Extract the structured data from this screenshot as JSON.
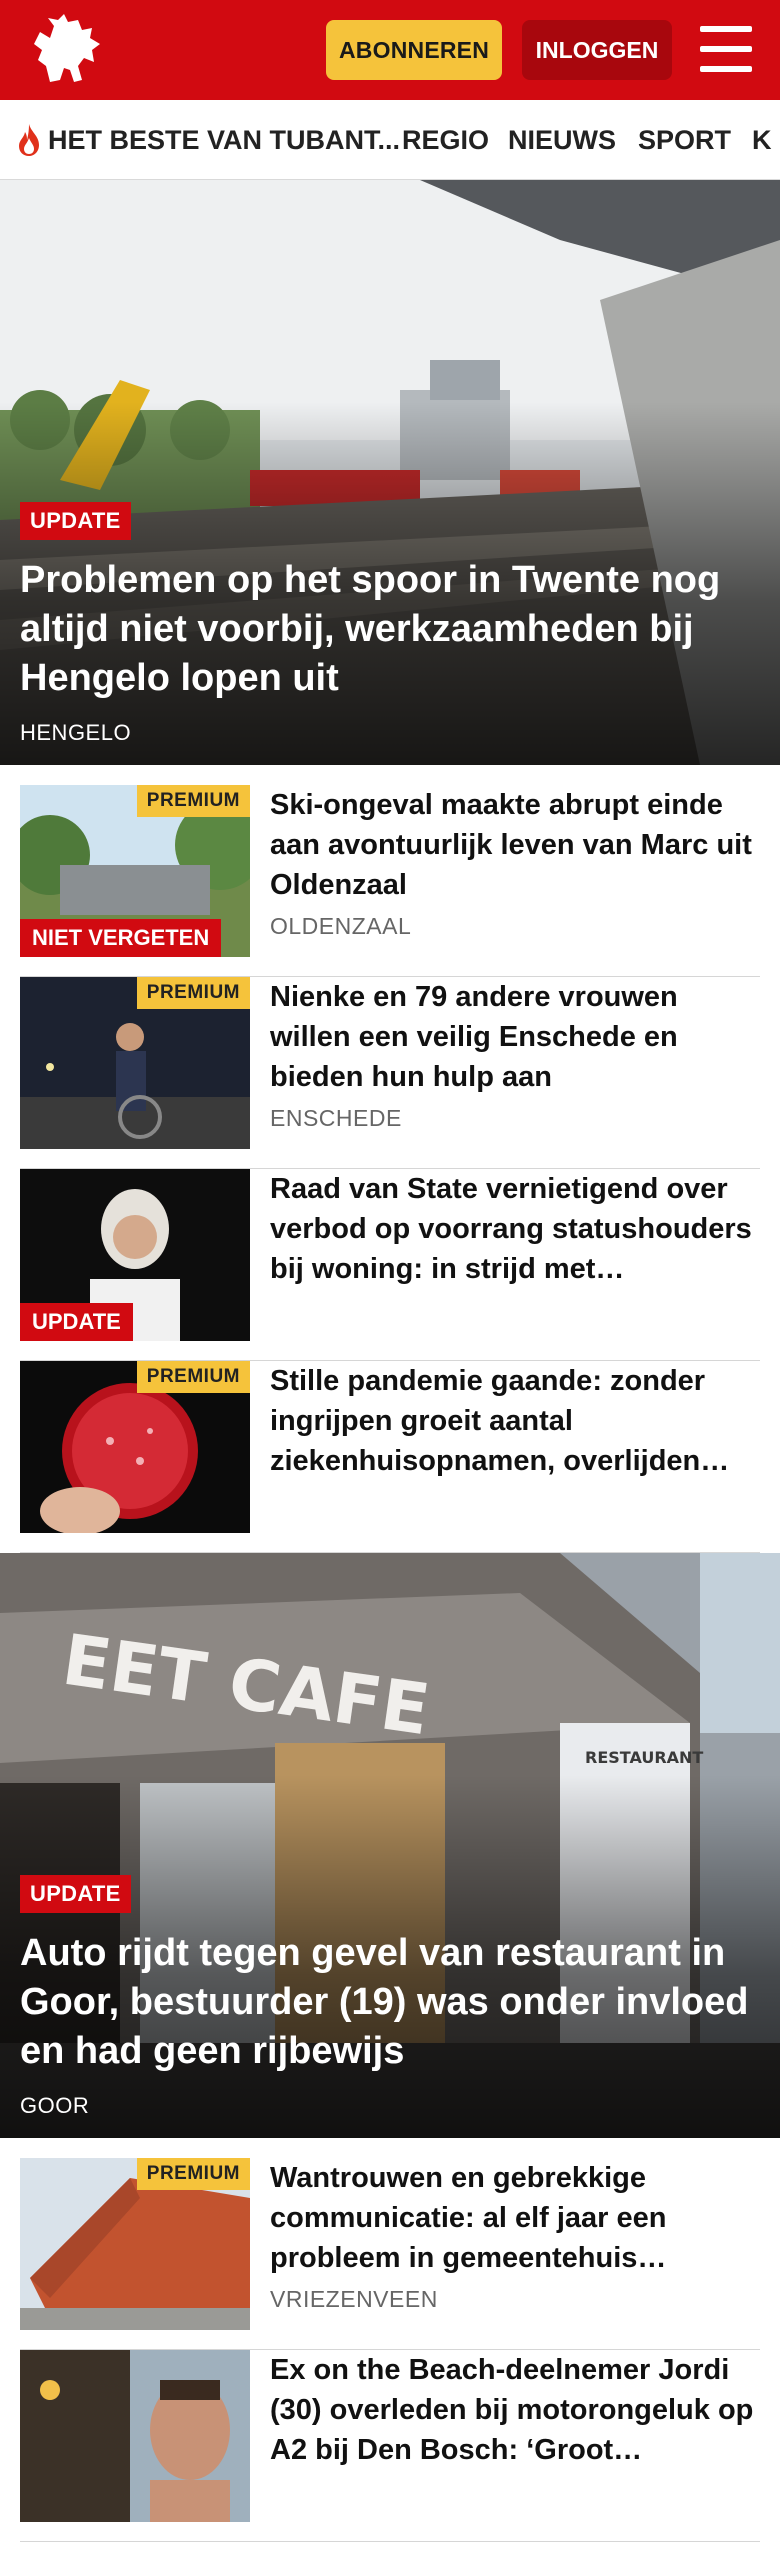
{
  "header": {
    "logo": "tubantia-horse-logo",
    "subscribe_label": "ABONNEREN",
    "login_label": "INLOGGEN",
    "menu_icon": "hamburger-icon",
    "colors": {
      "brand_red": "#d10a11",
      "accent_yellow": "#f5c33b",
      "login_dark_red": "#a8070d"
    }
  },
  "nav": {
    "items": [
      {
        "label": "HET BESTE VAN TUBANT...",
        "icon": "flame-icon"
      },
      {
        "label": "REGIO"
      },
      {
        "label": "NIEUWS"
      },
      {
        "label": "SPORT"
      },
      {
        "label": "K"
      }
    ]
  },
  "hero1": {
    "badge": "UPDATE",
    "title": "Problemen op het spoor in Twente nog altijd niet voorbij, werkzaamheden bij Hengelo lopen uit",
    "location": "HENGELO"
  },
  "articles1": [
    {
      "title": "Ski-ongeval maakte abrupt einde aan avontuurlijk leven van Marc uit Oldenzaal",
      "location": "OLDENZAAL",
      "premium": "PREMIUM",
      "tag": "NIET VERGETEN"
    },
    {
      "title": "Nienke en 79 andere vrouwen willen een veilig Enschede en bieden hun hulp aan",
      "location": "ENSCHEDE",
      "premium": "PREMIUM",
      "tag": ""
    },
    {
      "title": "Raad van State vernietigend over verbod op voorrang statushou­ders bij woning: in strijd met…",
      "location": "",
      "premium": "",
      "tag": "UPDATE"
    },
    {
      "title": "Stille pandemie gaande: zonder ingrijpen groeit aantal ziekenhuisopnamen, overlijden…",
      "location": "",
      "premium": "PREMIUM",
      "tag": ""
    }
  ],
  "hero2": {
    "badge": "UPDATE",
    "title": "Auto rijdt tegen gevel van restaurant in Goor, bestuurder (19) was onder invloed en had geen rijbewijs",
    "location": "GOOR",
    "sign_text": "EET CAFE",
    "small_sign": "RESTAURANT"
  },
  "articles2": [
    {
      "title": "Wantrouwen en gebrekkige communicatie: al elf jaar een probleem in gemeentehuis…",
      "location": "VRIEZENVEEN",
      "premium": "PREMIUM",
      "tag": ""
    },
    {
      "title": "Ex on the Beach-deelnemer Jordi (30) overleden bij motorongeluk op A2 bij Den Bosch: ‘Groot…",
      "location": "",
      "premium": "",
      "tag": ""
    }
  ]
}
